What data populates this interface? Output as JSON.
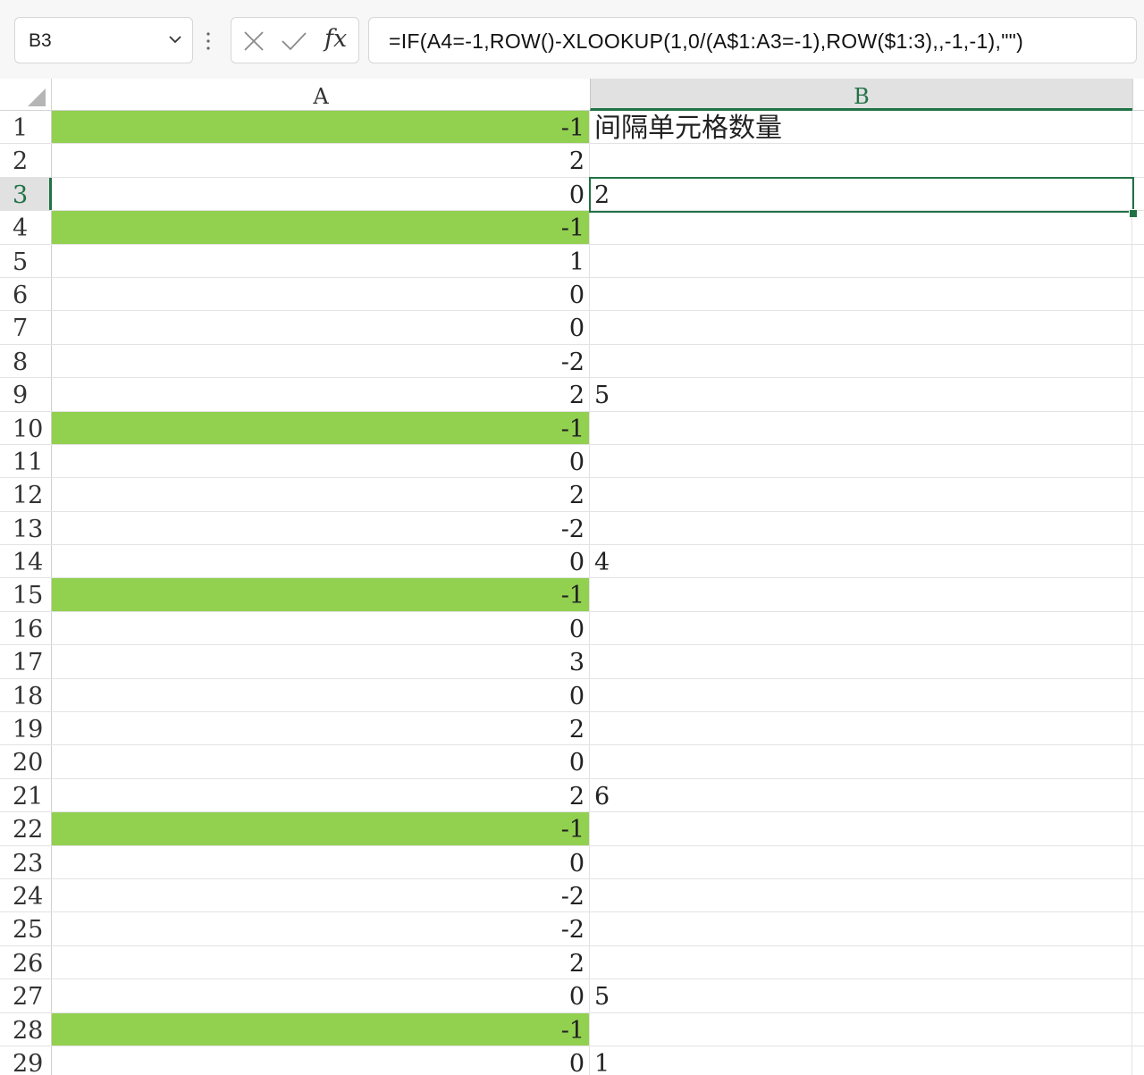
{
  "formula_bar": {
    "name_box": "B3",
    "formula": "=IF(A4=-1,ROW()-XLOOKUP(1,0/(A$1:A3=-1),ROW($1:3),,-1,-1),\"\")",
    "fx_label": "fx"
  },
  "columns": [
    {
      "label": "A"
    },
    {
      "label": "B"
    }
  ],
  "colors": {
    "highlight": "#92d050",
    "selection": "#217346"
  },
  "active_cell": "B3",
  "rows": [
    {
      "num": "1",
      "a": "-1",
      "b": "间隔单元格数量",
      "hl": true
    },
    {
      "num": "2",
      "a": "2",
      "b": "",
      "hl": false
    },
    {
      "num": "3",
      "a": "0",
      "b": "2",
      "hl": false
    },
    {
      "num": "4",
      "a": "-1",
      "b": "",
      "hl": true
    },
    {
      "num": "5",
      "a": "1",
      "b": "",
      "hl": false
    },
    {
      "num": "6",
      "a": "0",
      "b": "",
      "hl": false
    },
    {
      "num": "7",
      "a": "0",
      "b": "",
      "hl": false
    },
    {
      "num": "8",
      "a": "-2",
      "b": "",
      "hl": false
    },
    {
      "num": "9",
      "a": "2",
      "b": "5",
      "hl": false
    },
    {
      "num": "10",
      "a": "-1",
      "b": "",
      "hl": true
    },
    {
      "num": "11",
      "a": "0",
      "b": "",
      "hl": false
    },
    {
      "num": "12",
      "a": "2",
      "b": "",
      "hl": false
    },
    {
      "num": "13",
      "a": "-2",
      "b": "",
      "hl": false
    },
    {
      "num": "14",
      "a": "0",
      "b": "4",
      "hl": false
    },
    {
      "num": "15",
      "a": "-1",
      "b": "",
      "hl": true
    },
    {
      "num": "16",
      "a": "0",
      "b": "",
      "hl": false
    },
    {
      "num": "17",
      "a": "3",
      "b": "",
      "hl": false
    },
    {
      "num": "18",
      "a": "0",
      "b": "",
      "hl": false
    },
    {
      "num": "19",
      "a": "2",
      "b": "",
      "hl": false
    },
    {
      "num": "20",
      "a": "0",
      "b": "",
      "hl": false
    },
    {
      "num": "21",
      "a": "2",
      "b": "6",
      "hl": false
    },
    {
      "num": "22",
      "a": "-1",
      "b": "",
      "hl": true
    },
    {
      "num": "23",
      "a": "0",
      "b": "",
      "hl": false
    },
    {
      "num": "24",
      "a": "-2",
      "b": "",
      "hl": false
    },
    {
      "num": "25",
      "a": "-2",
      "b": "",
      "hl": false
    },
    {
      "num": "26",
      "a": "2",
      "b": "",
      "hl": false
    },
    {
      "num": "27",
      "a": "0",
      "b": "5",
      "hl": false
    },
    {
      "num": "28",
      "a": "-1",
      "b": "",
      "hl": true
    },
    {
      "num": "29",
      "a": "0",
      "b": "1",
      "hl": false
    }
  ]
}
